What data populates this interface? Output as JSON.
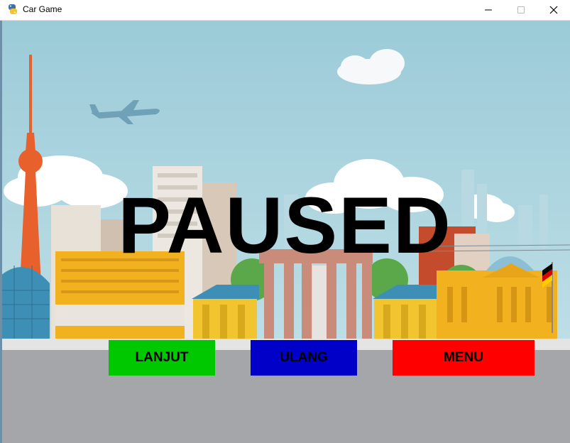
{
  "window": {
    "title": "Car Game",
    "icon": "python-snake-icon"
  },
  "overlay": {
    "status_text": "PAUSED"
  },
  "buttons": {
    "continue_label": "LANJUT",
    "restart_label": "ULANG",
    "menu_label": "MENU"
  },
  "colors": {
    "continue_bg": "#00c800",
    "restart_bg": "#0000c8",
    "menu_bg": "#ff0000",
    "button_text": "#000000",
    "sky": "#a9d3de",
    "road": "#a4a6aa"
  }
}
